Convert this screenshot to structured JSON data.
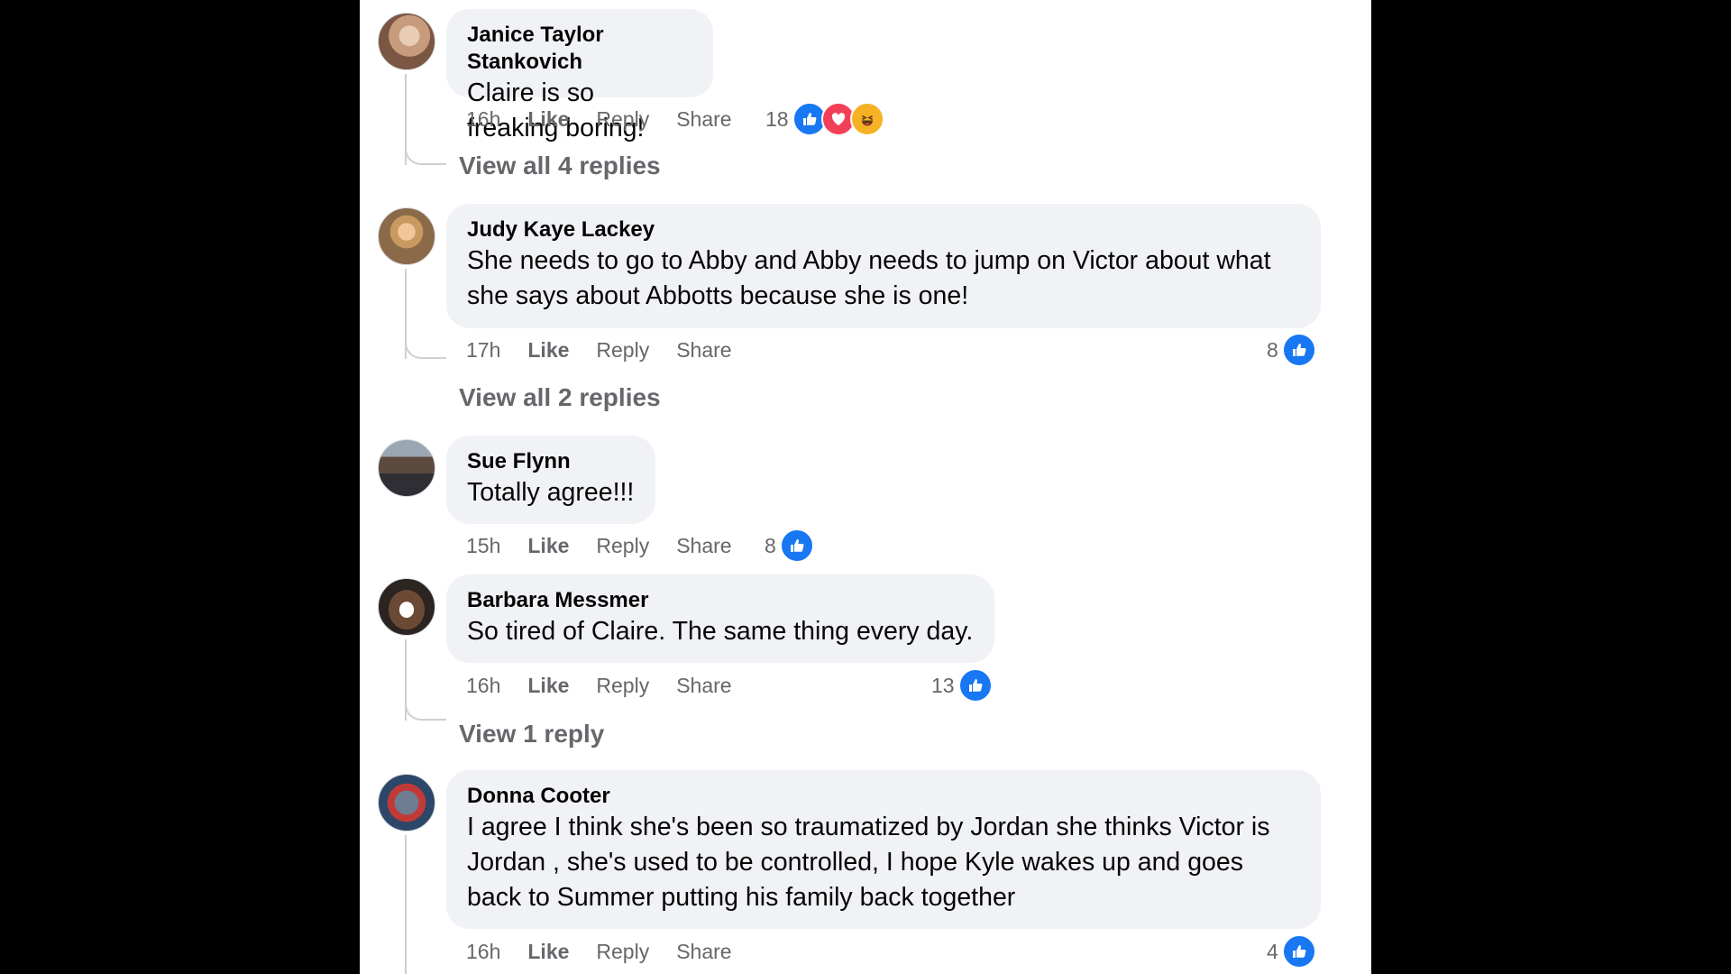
{
  "comments": [
    {
      "author": "Janice Taylor Stankovich",
      "text": "Claire is so freaking boring!",
      "time": "16h",
      "like": "Like",
      "reply": "Reply",
      "share": "Share",
      "reaction_count": "18",
      "reactions": [
        "like-icon",
        "love-icon",
        "haha-icon"
      ],
      "view_replies": "View all 4 replies"
    },
    {
      "author": "Judy Kaye Lackey",
      "text": "She needs to go to Abby and Abby needs to jump on Victor about what she says about Abbotts because she is one!",
      "time": "17h",
      "like": "Like",
      "reply": "Reply",
      "share": "Share",
      "reaction_count": "8",
      "reactions": [
        "like-icon"
      ],
      "view_replies": "View all 2 replies"
    },
    {
      "author": "Sue Flynn",
      "text": "Totally agree!!!",
      "time": "15h",
      "like": "Like",
      "reply": "Reply",
      "share": "Share",
      "reaction_count": "8",
      "reactions": [
        "like-icon"
      ]
    },
    {
      "author": "Barbara Messmer",
      "text": "So tired of Claire. The same thing every day.",
      "time": "16h",
      "like": "Like",
      "reply": "Reply",
      "share": "Share",
      "reaction_count": "13",
      "reactions": [
        "like-icon"
      ],
      "view_replies": "View 1 reply"
    },
    {
      "author": "Donna Cooter",
      "text": "I agree I think she's been so traumatized by Jordan she thinks Victor is Jordan , she's used to be controlled, I hope Kyle wakes up and goes back to Summer putting his family back together",
      "time": "16h",
      "like": "Like",
      "reply": "Reply",
      "share": "Share",
      "reaction_count": "4",
      "reactions": [
        "like-icon"
      ]
    }
  ],
  "colors": {
    "like_blue": "#1877f2",
    "love_red": "#f33e58",
    "haha_yellow": "#f7b125",
    "bubble_bg": "#f0f2f5",
    "meta_gray": "#65676b"
  }
}
